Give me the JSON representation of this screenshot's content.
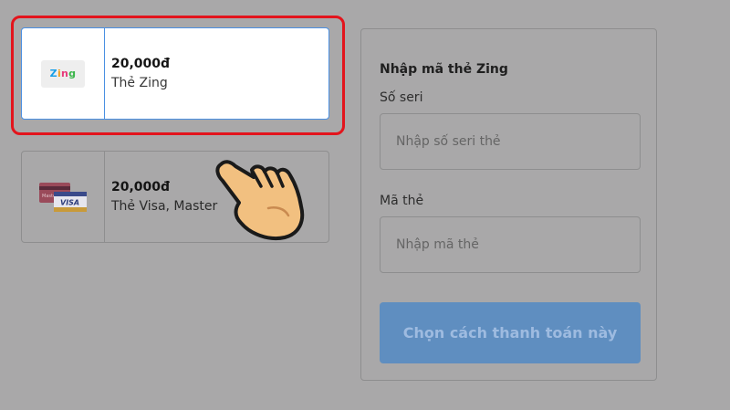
{
  "cards": [
    {
      "price": "20,000đ",
      "name": "Thẻ Zing",
      "logo_text": [
        "Z",
        "i",
        "n",
        "g"
      ],
      "selected": true
    },
    {
      "price": "20,000đ",
      "name": "Thẻ Visa, Master",
      "logo_text": [
        "Master",
        "VISA"
      ],
      "selected": false
    }
  ],
  "panel": {
    "title": "Nhập mã thẻ Zing",
    "serial_label": "Số seri",
    "serial_placeholder": "Nhập số seri thẻ",
    "code_label": "Mã thẻ",
    "code_placeholder": "Nhập mã thẻ",
    "submit_label": "Chọn cách thanh toán này"
  },
  "colors": {
    "overlay": "#a9a8a9",
    "highlight": "#e3141c",
    "selected_border": "#4a90e2",
    "button": "#5f8ec0"
  },
  "icons": {
    "pointer": "pointing-hand-icon"
  }
}
